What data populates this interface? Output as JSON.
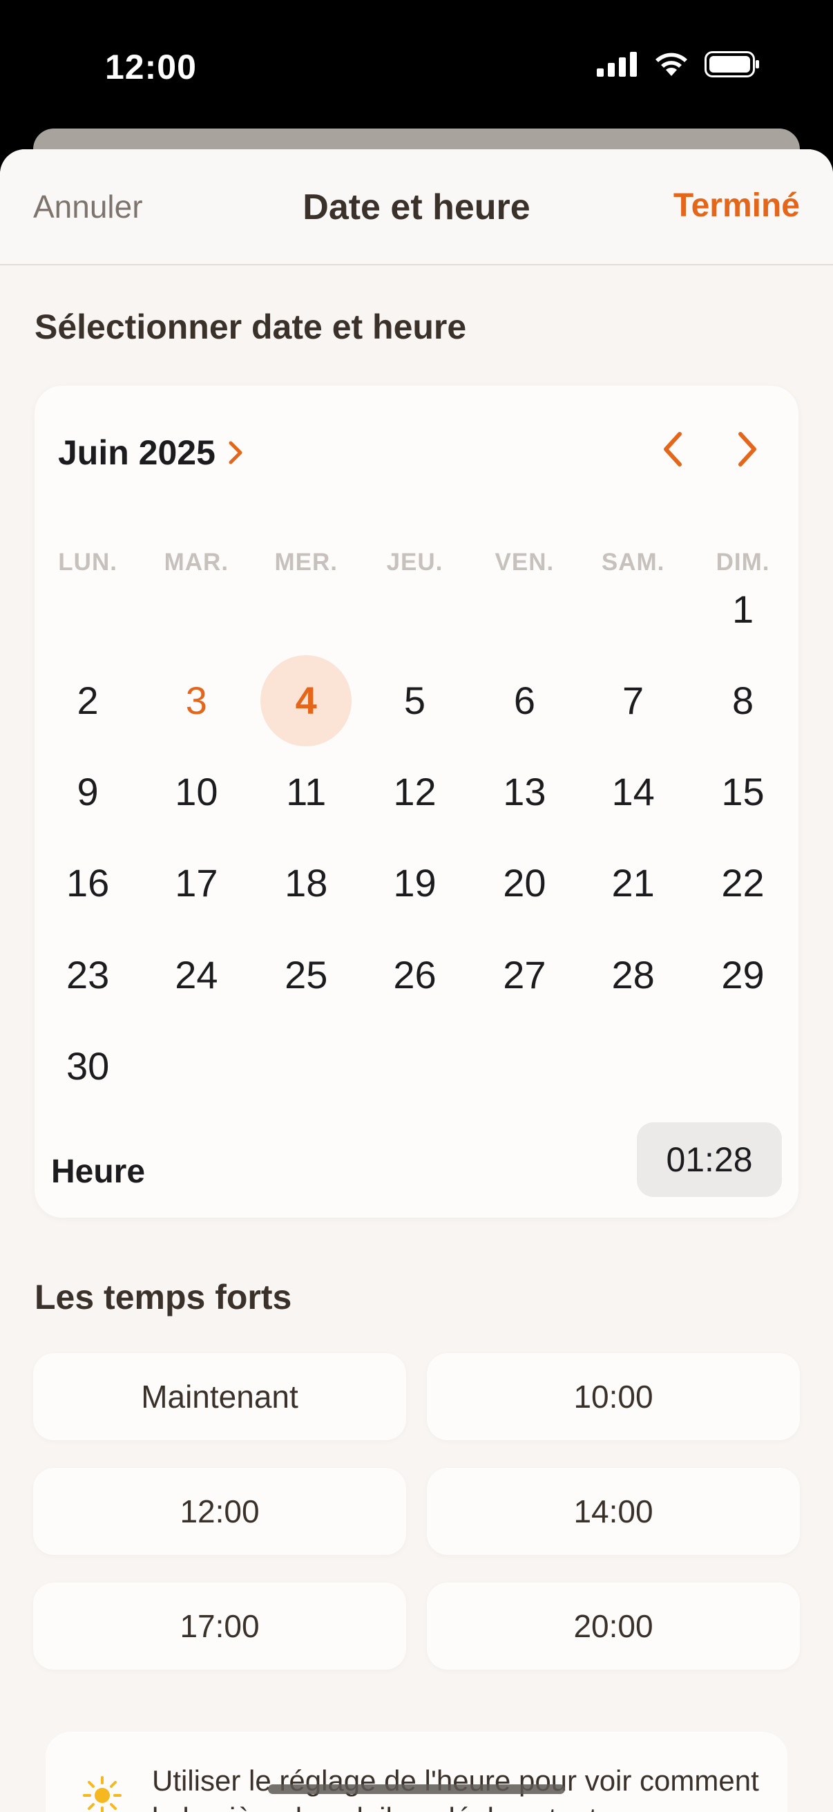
{
  "status_bar": {
    "time": "12:00"
  },
  "nav": {
    "cancel": "Annuler",
    "title": "Date et heure",
    "done": "Terminé"
  },
  "picker": {
    "section_title": "Sélectionner date et heure",
    "month": "Juin 2025",
    "weekdays": [
      "LUN.",
      "MAR.",
      "MER.",
      "JEU.",
      "VEN.",
      "SAM.",
      "DIM."
    ],
    "days": [
      "1",
      "2",
      "3",
      "4",
      "5",
      "6",
      "7",
      "8",
      "9",
      "10",
      "11",
      "12",
      "13",
      "14",
      "15",
      "16",
      "17",
      "18",
      "19",
      "20",
      "21",
      "22",
      "23",
      "24",
      "25",
      "26",
      "27",
      "28",
      "29",
      "30"
    ],
    "first_weekday_index": 6,
    "today": "3",
    "selected": "4",
    "time_label": "Heure",
    "time_value": "01:28"
  },
  "highlights": {
    "title": "Les temps forts",
    "buttons": [
      "Maintenant",
      "10:00",
      "12:00",
      "14:00",
      "17:00",
      "20:00"
    ]
  },
  "tip": {
    "text": "Utiliser le réglage de l'heure pour voir comment la lumière du soleil se déplace tout"
  },
  "colors": {
    "accent": "#e4661b",
    "selected_bg": "#fbe4d6",
    "background": "#f8f5f2"
  },
  "icons": {
    "sun": "sun-icon",
    "back": "chevron-left-icon",
    "forward": "chevron-right-icon"
  }
}
